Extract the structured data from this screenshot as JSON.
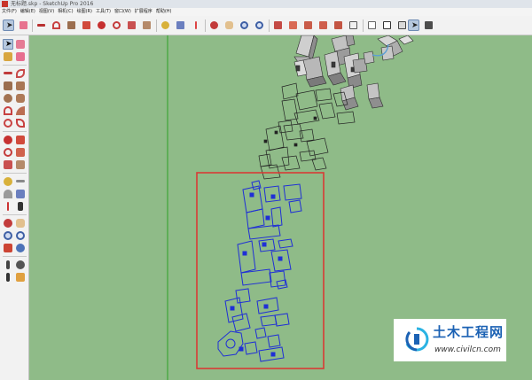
{
  "window": {
    "title": "无标题.skp - SketchUp Pro 2016"
  },
  "menu": {
    "items": [
      "文件(F)",
      "编辑(E)",
      "视图(V)",
      "相机(C)",
      "绘图(R)",
      "工具(T)",
      "窗口(W)",
      "扩展程序",
      "帮助(H)"
    ]
  },
  "toolbar": {
    "tools": [
      "select-tool",
      "eraser-tool",
      "line-tool",
      "arc-tool",
      "rectangle-tool",
      "push-pull-tool",
      "move-tool",
      "rotate-tool",
      "scale-tool",
      "offset-tool",
      "tape-measure-tool",
      "text-tool",
      "axes-tool",
      "dimension-tool",
      "protractor-tool",
      "section-plane-tool",
      "orbit-tool",
      "pan-tool",
      "zoom-tool",
      "zoom-extents-tool",
      "iso-view",
      "top-view",
      "front-view",
      "right-view",
      "back-view",
      "left-view",
      "x-ray-style",
      "wireframe-style",
      "hidden-line-style",
      "shaded-style",
      "textured-style",
      "monochrome-style",
      "warehouse",
      "extension-warehouse",
      "share-model",
      "component-tool",
      "layout-tool"
    ],
    "selected": "select-tool"
  },
  "sidebar": {
    "tools": [
      "select-tool",
      "make-component-tool",
      "paint-bucket-tool",
      "eraser-tool",
      "line-tool",
      "freehand-tool",
      "rectangle-tool",
      "rotated-rectangle-tool",
      "circle-tool",
      "polygon-tool",
      "arc-tool",
      "pie-tool",
      "2-point-arc-tool",
      "3-point-arc-tool",
      "move-tool",
      "push-pull-tool",
      "rotate-tool",
      "follow-me-tool",
      "scale-tool",
      "offset-tool",
      "tape-measure-tool",
      "dimension-tool",
      "protractor-tool",
      "text-tool",
      "axes-tool",
      "3d-text-tool",
      "orbit-tool",
      "pan-tool",
      "zoom-tool",
      "zoom-window-tool",
      "zoom-extents-tool",
      "previous-view-tool",
      "position-camera-tool",
      "look-around-tool",
      "walk-tool",
      "section-plane-tool"
    ]
  },
  "colors": {
    "viewport_background": "#8fbb88",
    "selection_blue": "#1f2fd6",
    "selection_box": "#d83a35",
    "green_axis": "#3ea637",
    "watermark_blue": "#1c62b4",
    "watermark_cyan": "#2bb3e3"
  },
  "watermark": {
    "name": "土木工程网",
    "url": "www.civilcn.com"
  }
}
